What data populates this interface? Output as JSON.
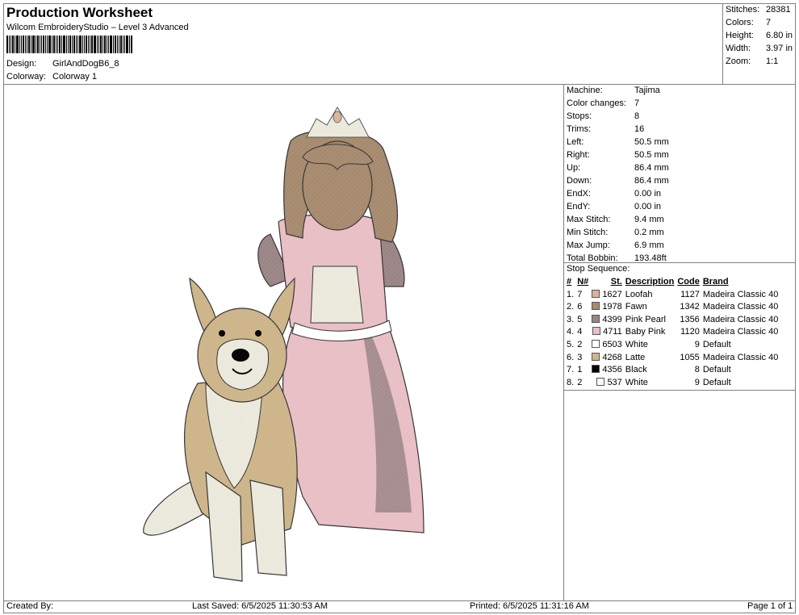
{
  "header": {
    "title": "Production Worksheet",
    "software": "Wilcom EmbroideryStudio – Level 3 Advanced",
    "design_label": "Design:",
    "design_value": "GirlAndDogB6_8",
    "colorway_label": "Colorway:",
    "colorway_value": "Colorway 1"
  },
  "summary": [
    {
      "label": "Stitches:",
      "value": "28381"
    },
    {
      "label": "Colors:",
      "value": "7"
    },
    {
      "label": "Height:",
      "value": "6.80 in"
    },
    {
      "label": "Width:",
      "value": "3.97 in"
    },
    {
      "label": "Zoom:",
      "value": "1:1"
    }
  ],
  "machine_info": [
    {
      "label": "Machine:",
      "value": "Tajima"
    },
    {
      "label": "Color changes:",
      "value": "7"
    },
    {
      "label": "Stops:",
      "value": "8"
    },
    {
      "label": "Trims:",
      "value": "16"
    },
    {
      "label": "Left:",
      "value": "50.5 mm"
    },
    {
      "label": "Right:",
      "value": "50.5 mm"
    },
    {
      "label": "Up:",
      "value": "86.4 mm"
    },
    {
      "label": "Down:",
      "value": "86.4 mm"
    },
    {
      "label": "EndX:",
      "value": "0.00 in"
    },
    {
      "label": "EndY:",
      "value": "0.00 in"
    },
    {
      "label": "Max Stitch:",
      "value": "9.4 mm"
    },
    {
      "label": "Min Stitch:",
      "value": "0.2 mm"
    },
    {
      "label": "Max Jump:",
      "value": "6.9 mm"
    },
    {
      "label": "Total Bobbin:",
      "value": "193.48ft"
    }
  ],
  "stop_sequence": {
    "title": "Stop Sequence:",
    "headers": [
      "#",
      "N#",
      "St.",
      "Description",
      "Code",
      "Brand"
    ],
    "rows": [
      {
        "idx": "1.",
        "n": "7",
        "color": "#d9b49a",
        "st": "1627",
        "desc": "Loofah",
        "code": "1127",
        "brand": "Madeira Classic 40"
      },
      {
        "idx": "2.",
        "n": "6",
        "color": "#a68a6e",
        "st": "1978",
        "desc": "Fawn",
        "code": "1342",
        "brand": "Madeira Classic 40"
      },
      {
        "idx": "3.",
        "n": "5",
        "color": "#9a8486",
        "st": "4399",
        "desc": "Pink Pearl",
        "code": "1356",
        "brand": "Madeira Classic 40"
      },
      {
        "idx": "4.",
        "n": "4",
        "color": "#e8bfc4",
        "st": "4711",
        "desc": "Baby Pink",
        "code": "1120",
        "brand": "Madeira Classic 40"
      },
      {
        "idx": "5.",
        "n": "2",
        "color": "#ffffff",
        "st": "6503",
        "desc": "White",
        "code": "9",
        "brand": "Default"
      },
      {
        "idx": "6.",
        "n": "3",
        "color": "#cdb489",
        "st": "4268",
        "desc": "Latte",
        "code": "1055",
        "brand": "Madeira Classic 40"
      },
      {
        "idx": "7.",
        "n": "1",
        "color": "#000000",
        "st": "4356",
        "desc": "Black",
        "code": "8",
        "brand": "Default"
      },
      {
        "idx": "8.",
        "n": "2",
        "color": "#ffffff",
        "st": "537",
        "desc": "White",
        "code": "9",
        "brand": "Default"
      }
    ]
  },
  "footer": {
    "created_by": "Created By:",
    "last_saved": "Last Saved: 6/5/2025 11:30:53 AM",
    "printed": "Printed: 6/5/2025 11:31:16 AM",
    "page": "Page 1 of 1"
  },
  "colors": {
    "border": "#808080",
    "hair": "#a68a6e",
    "skin": "#a68a6e",
    "dress": "#e8bfc4",
    "dress_shadow": "#9a8486",
    "dog_tan": "#cdb489",
    "dog_white": "#ebe9dc"
  }
}
